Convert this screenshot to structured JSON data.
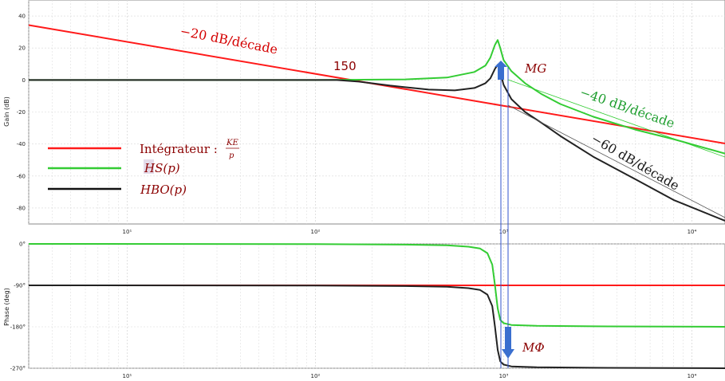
{
  "chart_data": [
    {
      "type": "line",
      "panel": "magnitude",
      "ylabel": "Gain (dB)",
      "xscale": "log",
      "xlim": [
        3,
        15000
      ],
      "ylim": [
        -90,
        50
      ],
      "yticks": [
        40,
        20,
        0,
        -20,
        -40,
        -60,
        -80
      ],
      "xticks": [
        {
          "v": 10,
          "label": "10¹"
        },
        {
          "v": 100,
          "label": "10²"
        },
        {
          "v": 1000,
          "label": "10³"
        },
        {
          "v": 10000,
          "label": "10⁴"
        }
      ],
      "grid": true,
      "legend_position": "left",
      "series": [
        {
          "key": "integ",
          "name": "Intégrateur :",
          "name_fraction": {
            "num": "KE",
            "den": "p"
          },
          "color": "#ff1a1a",
          "x": [
            3,
            15000
          ],
          "y": [
            34.3,
            -39.7
          ]
        },
        {
          "key": "hs",
          "name": "HS(p)",
          "color": "#33cc33",
          "x": [
            3,
            100,
            300,
            500,
            700,
            800,
            850,
            900,
            930,
            960,
            1000,
            1100,
            1300,
            1600,
            2000,
            3000,
            5000,
            8000,
            15000
          ],
          "y": [
            0,
            0,
            0.4,
            1.5,
            5,
            9,
            14,
            22,
            25,
            20,
            12.5,
            5.5,
            -2,
            -9,
            -15,
            -23,
            -31,
            -37,
            -46
          ]
        },
        {
          "key": "hbo",
          "name": "HBO(p)",
          "color": "#222222",
          "x": [
            3,
            100,
            130,
            170,
            250,
            400,
            550,
            700,
            800,
            850,
            900,
            930,
            960,
            1000,
            1100,
            1300,
            1600,
            2000,
            3000,
            5000,
            8000,
            15000
          ],
          "y": [
            0,
            0,
            0,
            -1,
            -3.5,
            -6,
            -6.5,
            -5,
            -2,
            1,
            7,
            9.5,
            5,
            -3,
            -12,
            -20,
            -27,
            -35,
            -48,
            -62,
            -75,
            -88
          ]
        }
      ],
      "annotations": [
        {
          "text": "−20 dB/décade",
          "style": "red"
        },
        {
          "text": "150"
        },
        {
          "text": "MG"
        },
        {
          "text": "−40 dB/décade",
          "style": "green"
        },
        {
          "text": "−60 dB/décade",
          "style": "black"
        }
      ]
    },
    {
      "type": "line",
      "panel": "phase",
      "ylabel": "Phase (deg)",
      "xscale": "log",
      "xlim": [
        3,
        15000
      ],
      "ylim": [
        -270,
        0
      ],
      "yticks": [
        {
          "v": 0,
          "label": "0°"
        },
        {
          "v": -90,
          "label": "-90°"
        },
        {
          "v": -180,
          "label": "-180°"
        },
        {
          "v": -270,
          "label": "-270°"
        }
      ],
      "xticks": [
        {
          "v": 10,
          "label": "10¹"
        },
        {
          "v": 100,
          "label": "10²"
        },
        {
          "v": 1000,
          "label": "10³"
        },
        {
          "v": 10000,
          "label": "10⁴"
        }
      ],
      "grid": true,
      "series": [
        {
          "key": "integ",
          "color": "#ff1a1a",
          "x": [
            3,
            15000
          ],
          "y": [
            -90,
            -90
          ]
        },
        {
          "key": "hs",
          "color": "#33cc33",
          "x": [
            3,
            100,
            300,
            500,
            650,
            750,
            820,
            870,
            900,
            930,
            960,
            1000,
            1100,
            1500,
            3000,
            15000
          ],
          "y": [
            0,
            -0.3,
            -1.5,
            -3,
            -6,
            -10,
            -20,
            -45,
            -90,
            -140,
            -165,
            -172,
            -176,
            -178,
            -179,
            -180
          ]
        },
        {
          "key": "hbo",
          "color": "#222222",
          "x": [
            3,
            100,
            300,
            500,
            650,
            750,
            820,
            870,
            900,
            930,
            960,
            1000,
            1100,
            1500,
            3000,
            15000
          ],
          "y": [
            -90,
            -90.3,
            -91.5,
            -93,
            -96,
            -100,
            -110,
            -135,
            -180,
            -230,
            -255,
            -262,
            -266,
            -268,
            -269,
            -270
          ]
        }
      ],
      "annotations": [
        {
          "text": "MΦ"
        }
      ]
    }
  ]
}
